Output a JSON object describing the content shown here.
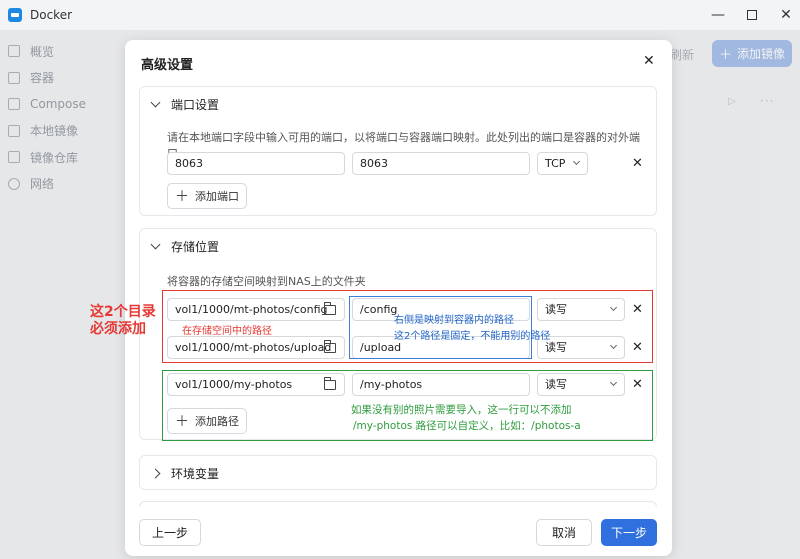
{
  "window": {
    "title": "Docker"
  },
  "sidebar": {
    "items": [
      {
        "label": "概览",
        "icon": "grid-icon"
      },
      {
        "label": "容器",
        "icon": "cube-icon"
      },
      {
        "label": "Compose",
        "icon": "layers-icon"
      },
      {
        "label": "本地镜像",
        "icon": "image-icon"
      },
      {
        "label": "镜像仓库",
        "icon": "registry-icon"
      },
      {
        "label": "网络",
        "icon": "globe-icon"
      }
    ]
  },
  "background": {
    "refresh_label": "刷新",
    "add_image_label": "添加镜像"
  },
  "dialog": {
    "title": "高级设置",
    "ports": {
      "header": "端口设置",
      "description": "请在本地端口字段中输入可用的端口，以将端口与容器端口映射。此处列出的端口是容器的对外端口。",
      "rows": [
        {
          "local": "8063",
          "container": "8063",
          "protocol": "TCP"
        }
      ],
      "add_label": "添加端口"
    },
    "storage": {
      "header": "存储位置",
      "description": "将容器的存储空间映射到NAS上的文件夹",
      "rows": [
        {
          "host": "vol1/1000/mt-photos/config",
          "container": "/config",
          "mode": "读写"
        },
        {
          "host": "vol1/1000/mt-photos/upload",
          "container": "/upload",
          "mode": "读写"
        },
        {
          "host": "vol1/1000/my-photos",
          "container": "/my-photos",
          "mode": "读写"
        }
      ],
      "add_label": "添加路径"
    },
    "env": {
      "header": "环境变量"
    },
    "footer": {
      "prev_label": "上一步",
      "cancel_label": "取消",
      "next_label": "下一步"
    }
  },
  "annotations": {
    "side_line1": "这2个目录",
    "side_line2": "必须添加",
    "host_path_note": "在存储空间中的路径",
    "container_note_1": "右侧是映射到容器内的路径",
    "container_note_2": "这2个路径是固定，不能用别的路径",
    "optional_note_1": "如果没有别的照片需要导入，这一行可以不添加",
    "optional_note_2": "/my-photos 路径可以自定义，比如：/photos-a"
  },
  "colors": {
    "primary": "#2f6fde",
    "annotation_red": "#e53935",
    "annotation_blue": "#1f63c8",
    "annotation_green": "#2e9b3f"
  }
}
